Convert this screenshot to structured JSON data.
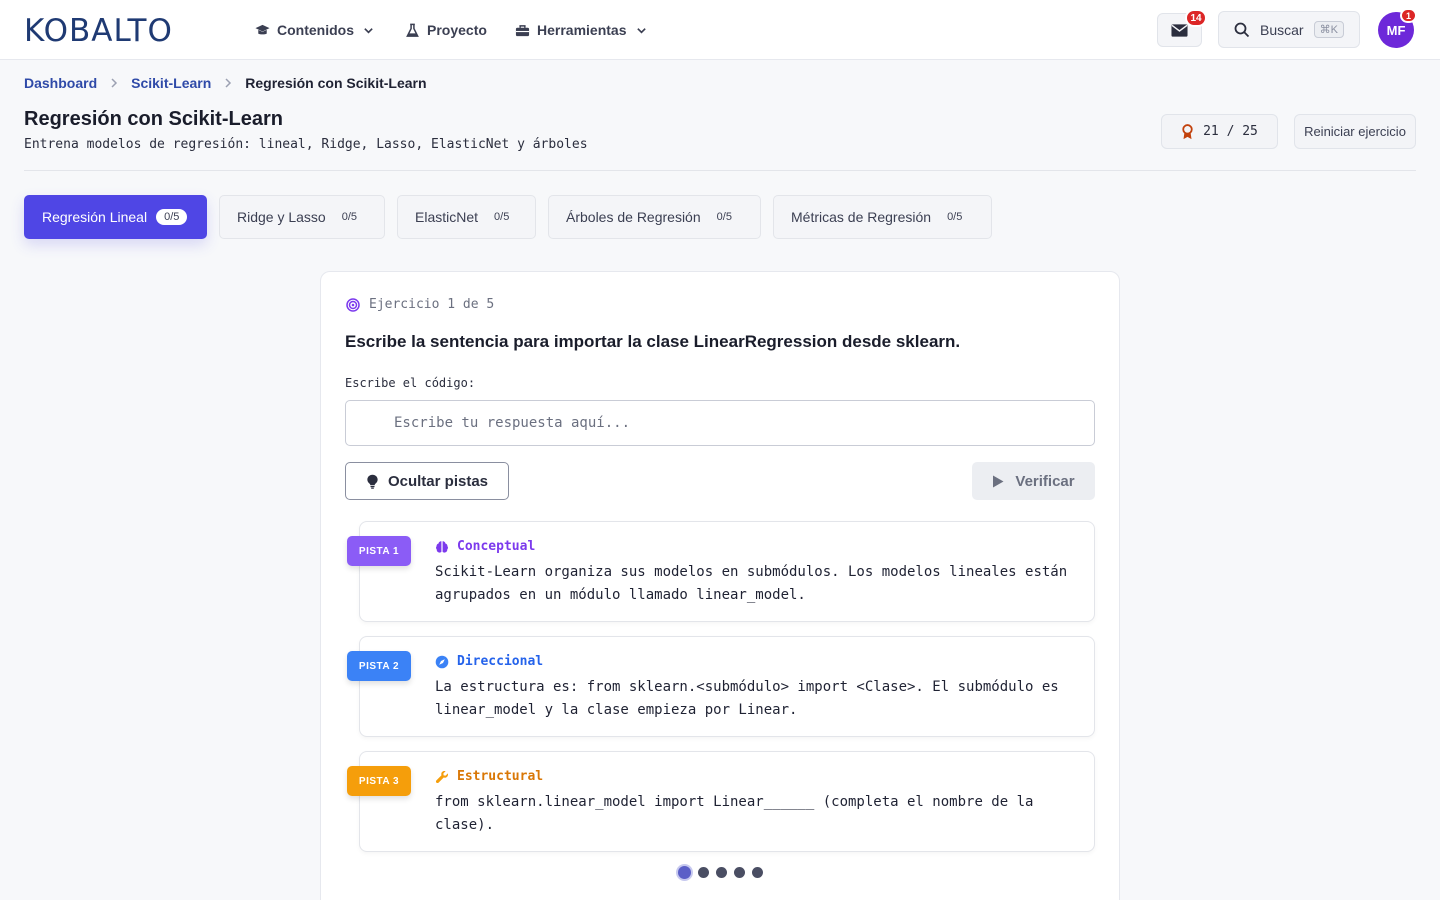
{
  "brand": {
    "logo_text": "KOBALTO"
  },
  "nav": {
    "items": [
      {
        "label": "Contenidos",
        "icon": "graduation-cap-icon",
        "dropdown": true
      },
      {
        "label": "Proyecto",
        "icon": "flask-icon",
        "dropdown": false
      },
      {
        "label": "Herramientas",
        "icon": "toolbox-icon",
        "dropdown": true
      }
    ],
    "mail_badge": "14",
    "search_label": "Buscar",
    "search_shortcut": "⌘K",
    "avatar_initials": "MF",
    "avatar_badge": "1"
  },
  "breadcrumb": {
    "items": [
      "Dashboard",
      "Scikit-Learn"
    ],
    "current": "Regresión con Scikit-Learn"
  },
  "header": {
    "title": "Regresión con Scikit-Learn",
    "subtitle": "Entrena modelos de regresión: lineal, Ridge, Lasso, ElasticNet y árboles",
    "score": "21 / 25",
    "reset_label": "Reiniciar ejercicio"
  },
  "tabs": [
    {
      "label": "Regresión Lineal",
      "count": "0/5",
      "active": true
    },
    {
      "label": "Ridge y Lasso",
      "count": "0/5",
      "active": false
    },
    {
      "label": "ElasticNet",
      "count": "0/5",
      "active": false
    },
    {
      "label": "Árboles de Regresión",
      "count": "0/5",
      "active": false
    },
    {
      "label": "Métricas de Regresión",
      "count": "0/5",
      "active": false
    }
  ],
  "exercise": {
    "counter": "Ejercicio 1 de 5",
    "question": "Escribe la sentencia para importar la clase LinearRegression desde sklearn.",
    "code_label": "Escribe el código:",
    "answer_placeholder": "Escribe tu respuesta aquí...",
    "answer_value": "",
    "hide_hints_label": "Ocultar pistas",
    "verify_label": "Verificar",
    "hints": [
      {
        "tag": "PISTA 1",
        "type": "Conceptual",
        "color": "#8b5cf6",
        "text_color": "#7c3aed",
        "icon": "brain-icon",
        "text": "Scikit-Learn organiza sus modelos en submódulos. Los modelos lineales están agrupados en un módulo llamado linear_model."
      },
      {
        "tag": "PISTA 2",
        "type": "Direccional",
        "color": "#3b82f6",
        "text_color": "#2563eb",
        "icon": "compass-icon",
        "text": "La estructura es: from sklearn.<submódulo> import <Clase>. El submódulo es linear_model y la clase empieza por Linear."
      },
      {
        "tag": "PISTA 3",
        "type": "Estructural",
        "color": "#f59e0b",
        "text_color": "#d97706",
        "icon": "wrench-icon",
        "text": "from sklearn.linear_model import Linear______ (completa el nombre de la clase)."
      }
    ],
    "pagination": {
      "total": 5,
      "current": 1
    }
  },
  "colors": {
    "primary": "#4f46e5",
    "brand": "#1f3a73",
    "badge": "#dc2626",
    "avatar": "#6d28d9"
  }
}
